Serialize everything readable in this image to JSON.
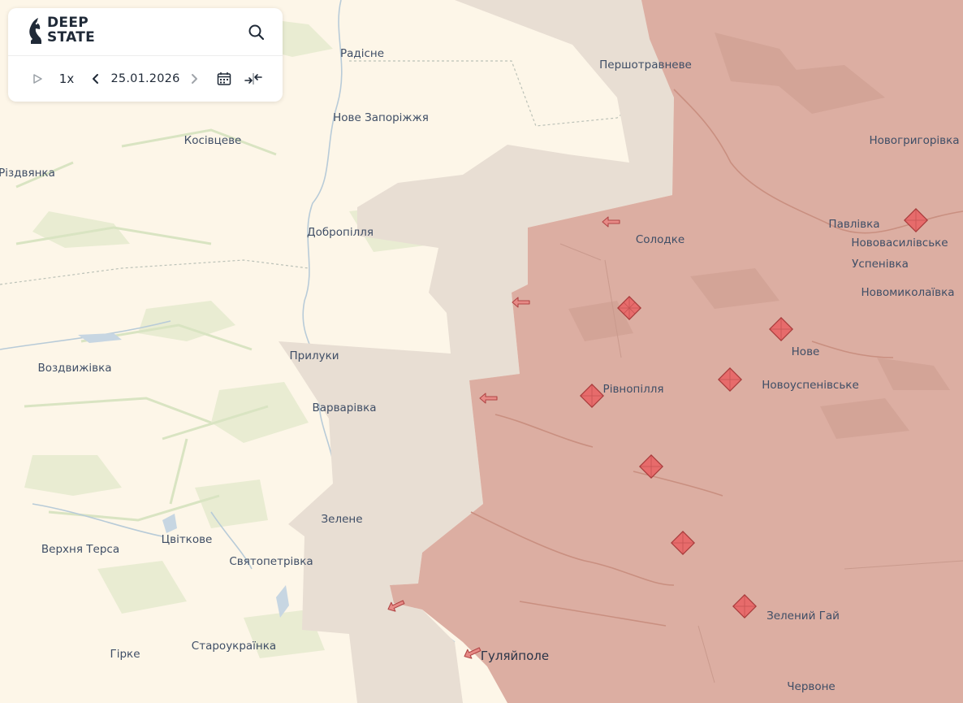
{
  "app": {
    "brand_line1": "DEEP",
    "brand_line2": "STATE",
    "speed": "1x",
    "date": "25.01.2026"
  },
  "icons": [
    "deepstate-logo-icon",
    "search-icon",
    "play-icon",
    "chevron-left-icon",
    "chevron-right-icon",
    "calendar-icon",
    "compare-arrows-icon"
  ],
  "colors": {
    "free_land": "#fdf6e8",
    "occupied": "#dcaea2",
    "gray_zone": "#e8ded3",
    "attack_arrow": "#c25050",
    "assault_marker": "#e76b6b"
  },
  "places": [
    {
      "id": "radisne",
      "name": "Радісне"
    },
    {
      "id": "pershotravneve",
      "name": "Першотравневе"
    },
    {
      "id": "nove-zaporizhzhia",
      "name": "Нове Запоріжжя"
    },
    {
      "id": "kosivtseve",
      "name": "Косівцеве"
    },
    {
      "id": "novohryhorivka",
      "name": "Новогригорівка"
    },
    {
      "id": "rizdvianka",
      "name": "Різдвянка"
    },
    {
      "id": "dobropillia",
      "name": "Добропілля"
    },
    {
      "id": "solodke",
      "name": "Солодке"
    },
    {
      "id": "pavlivka",
      "name": "Павлівка"
    },
    {
      "id": "novovasylivske",
      "name": "Нововасилівське"
    },
    {
      "id": "uspenivka",
      "name": "Успенівка"
    },
    {
      "id": "novomykolaivka",
      "name": "Новомиколаївка"
    },
    {
      "id": "nove",
      "name": "Нове"
    },
    {
      "id": "pryluky",
      "name": "Прилуки"
    },
    {
      "id": "vozdvyzhivka",
      "name": "Воздвижівка"
    },
    {
      "id": "rivnopillia",
      "name": "Рівнопілля"
    },
    {
      "id": "novouspenivske",
      "name": "Новоуспенівське"
    },
    {
      "id": "varvarivka",
      "name": "Варварівка"
    },
    {
      "id": "zelene",
      "name": "Зелене"
    },
    {
      "id": "tsvitkove",
      "name": "Цвіткове"
    },
    {
      "id": "verkhnia-tersa",
      "name": "Верхня Терса"
    },
    {
      "id": "sviatopetrivka",
      "name": "Святопетрівка"
    },
    {
      "id": "zelenyi-hai",
      "name": "Зелений Гай"
    },
    {
      "id": "hirke",
      "name": "Гірке"
    },
    {
      "id": "staroukrainka",
      "name": "Староукраїнка"
    },
    {
      "id": "huliaipole",
      "name": "Гуляйполе"
    },
    {
      "id": "chervone",
      "name": "Червоне"
    }
  ]
}
